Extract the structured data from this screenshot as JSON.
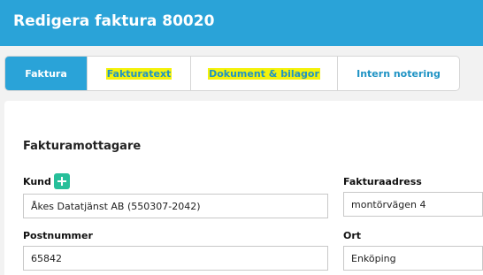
{
  "header": {
    "title": "Redigera faktura 80020"
  },
  "tabs": [
    {
      "label": "Faktura",
      "active": true,
      "highlighted": false
    },
    {
      "label": "Fakturatext",
      "active": false,
      "highlighted": true
    },
    {
      "label": "Dokument & bilagor",
      "active": false,
      "highlighted": true
    },
    {
      "label": "Intern notering",
      "active": false,
      "highlighted": false
    }
  ],
  "section": {
    "title": "Fakturamottagare"
  },
  "form": {
    "kund": {
      "label": "Kund",
      "value": "Åkes Datatjänst AB (550307-2042)",
      "add_icon": "plus-icon"
    },
    "fakturaadress": {
      "label": "Fakturaadress",
      "value": "montörvägen 4"
    },
    "postnummer": {
      "label": "Postnummer",
      "value": "65842"
    },
    "ort": {
      "label": "Ort",
      "value": "Enköping"
    }
  },
  "colors": {
    "accent": "#2aa3d8",
    "add_button": "#27bf9a",
    "highlight": "#f4f20a"
  }
}
